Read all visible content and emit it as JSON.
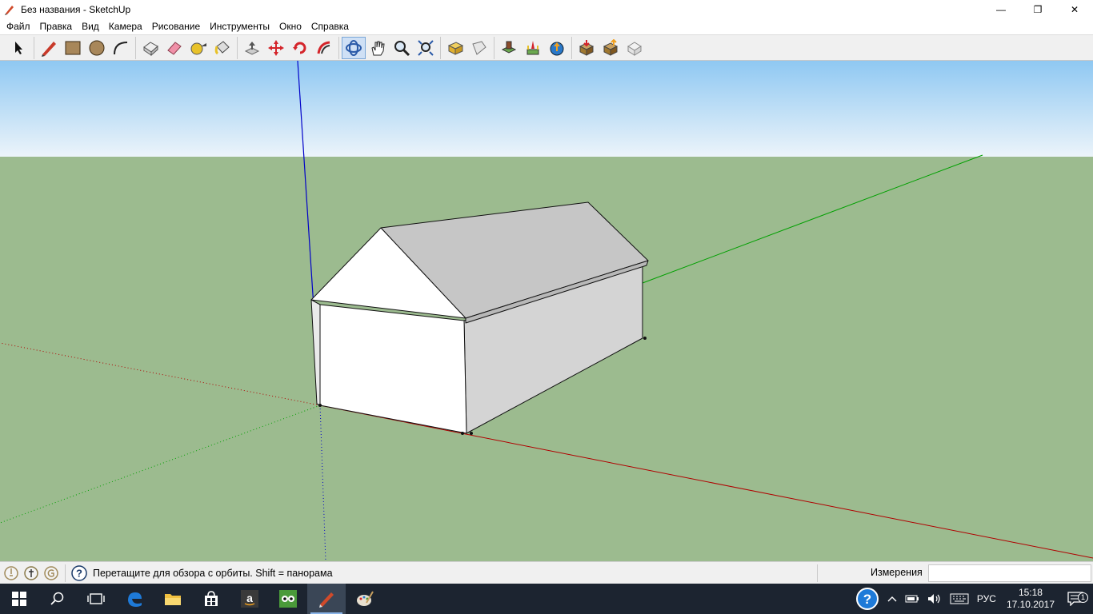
{
  "window": {
    "title": "Без названия - SketchUp",
    "minimize": "—",
    "restore": "❐",
    "close": "✕"
  },
  "menu": [
    "Файл",
    "Правка",
    "Вид",
    "Камера",
    "Рисование",
    "Инструменты",
    "Окно",
    "Справка"
  ],
  "toolbar": {
    "groups": [
      [
        "select-icon"
      ],
      [
        "pencil-icon",
        "rectangle-icon",
        "circle-icon",
        "arc-icon"
      ],
      [
        "make-component-icon",
        "eraser-icon",
        "tape-measure-icon",
        "paint-bucket-icon"
      ],
      [
        "push-pull-icon",
        "move-icon",
        "rotate-icon",
        "follow-me-icon"
      ],
      [
        "orbit-icon",
        "pan-icon",
        "zoom-icon",
        "zoom-extents-icon"
      ],
      [
        "previous-view-icon",
        "next-view-icon"
      ],
      [
        "warehouse-icon",
        "add-location-icon",
        "share-model-icon"
      ],
      [
        "get-models-icon",
        "share-component-icon",
        "extension-warehouse-icon"
      ]
    ],
    "active_tool": "orbit-icon"
  },
  "status": {
    "hint": "Перетащите для обзора с орбиты.  Shift = панорама",
    "measurements_label": "Измерения",
    "measurements_value": ""
  },
  "taskbar": {
    "apps": [
      "start-icon",
      "search-icon",
      "task-view-icon",
      "edge-icon",
      "file-explorer-icon",
      "store-icon",
      "amazon-icon",
      "tripadvisor-icon",
      "sketchup-icon",
      "paint-icon"
    ],
    "language": "РУС",
    "time": "15:18",
    "date": "17.10.2017",
    "notifications": "1"
  },
  "colors": {
    "sky_top": "#8fc8f2",
    "sky_bottom": "#ecf4fa",
    "ground": "#9cbb8f",
    "axis_red": "#b00000",
    "axis_green": "#00a000",
    "axis_blue": "#0000c8"
  }
}
